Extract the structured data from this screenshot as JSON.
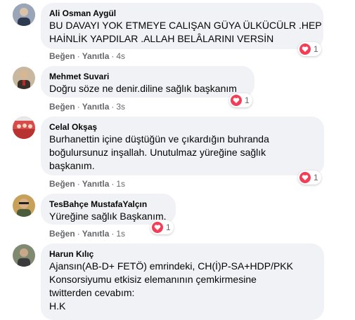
{
  "comments": [
    {
      "author": "Ali Osman Aygül",
      "lines": [
        "BU DAVAYI YOK ETMEYE CALIŞAN GÜYA ÜLKÜCÜLR .HEP",
        "HAİNLİK YAPDILAR .ALLAH BELÂLARINI VERSİN"
      ],
      "reaction_count": "1",
      "like_label": "Beğen",
      "reply_label": "Yanıtla",
      "time": "4s"
    },
    {
      "author": "Mehmet Suvari",
      "lines": [
        "Doğru söze ne denir.diline sağlık başkanım"
      ],
      "reaction_count": "1",
      "like_label": "Beğen",
      "reply_label": "Yanıtla",
      "time": "3s"
    },
    {
      "author": "Celal Okşaş",
      "lines": [
        "Burhanettin içine düştüğün ve çıkardığın buhranda",
        "boğulursunuz inşallah. Unutulmaz yüreğine sağlık",
        "başkanım."
      ],
      "reaction_count": "1",
      "like_label": "Beğen",
      "reply_label": "Yanıtla",
      "time": "1s"
    },
    {
      "author": "TesBahçe MustafaYalçın",
      "lines": [
        "Yüreğine sağlık Başkanım."
      ],
      "reaction_count": "1",
      "like_label": "Beğen",
      "reply_label": "Yanıtla",
      "time": "1s"
    },
    {
      "author": "Harun Kılıç",
      "lines": [
        "Ajansın(AB-D+ FETÖ) emrindeki, CH(İ)P-SA+HDP/PKK",
        "Konsorsiyumu etkisiz elemanının çemkirmesine",
        "twitterden cevabım:",
        "H.K"
      ]
    }
  ],
  "colors": {
    "bubble": "#f0f2f5",
    "heart": "#f33e58",
    "meta_text": "#65676b"
  },
  "icons": {
    "reaction": "heart-icon"
  }
}
